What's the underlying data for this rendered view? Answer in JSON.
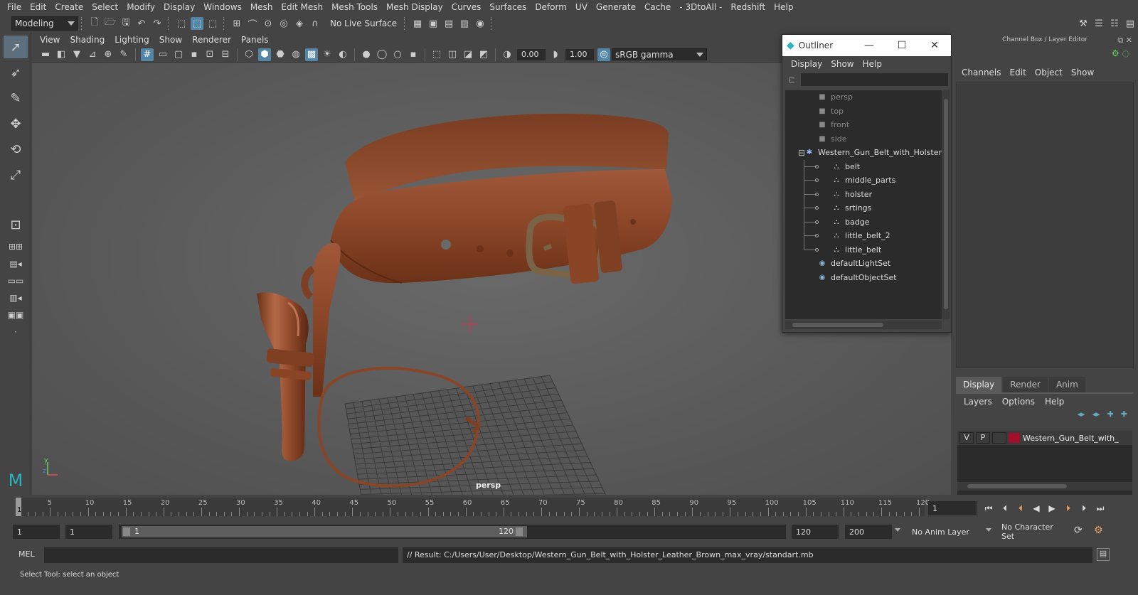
{
  "menubar": [
    "File",
    "Edit",
    "Create",
    "Select",
    "Modify",
    "Display",
    "Windows",
    "Mesh",
    "Edit Mesh",
    "Mesh Tools",
    "Mesh Display",
    "Curves",
    "Surfaces",
    "Deform",
    "UV",
    "Generate",
    "Cache",
    "- 3DtoAll -",
    "Redshift",
    "Help"
  ],
  "shelf": {
    "mode": "Modeling",
    "live_surface": "No Live Surface"
  },
  "viewport": {
    "menu": [
      "View",
      "Shading",
      "Lighting",
      "Show",
      "Renderer",
      "Panels"
    ],
    "exposure": "0.00",
    "gamma": "1.00",
    "color_space": "sRGB gamma",
    "camera_label": "persp"
  },
  "outliner": {
    "title": "Outliner",
    "menu": [
      "Display",
      "Show",
      "Help"
    ],
    "items": [
      {
        "label": "persp",
        "dim": true,
        "icon": "camera-icon"
      },
      {
        "label": "top",
        "dim": true,
        "icon": "camera-icon"
      },
      {
        "label": "front",
        "dim": true,
        "icon": "camera-icon"
      },
      {
        "label": "side",
        "dim": true,
        "icon": "camera-icon"
      },
      {
        "label": "Western_Gun_Belt_with_Holster",
        "dim": false,
        "icon": "group-icon"
      },
      {
        "label": "belt",
        "dim": false,
        "icon": "mesh-icon"
      },
      {
        "label": "middle_parts",
        "dim": false,
        "icon": "mesh-icon"
      },
      {
        "label": "holster",
        "dim": false,
        "icon": "mesh-icon"
      },
      {
        "label": "srtings",
        "dim": false,
        "icon": "mesh-icon"
      },
      {
        "label": "badge",
        "dim": false,
        "icon": "mesh-icon"
      },
      {
        "label": "little_belt_2",
        "dim": false,
        "icon": "mesh-icon"
      },
      {
        "label": "little_belt",
        "dim": false,
        "icon": "mesh-icon"
      },
      {
        "label": "defaultLightSet",
        "dim": false,
        "icon": "set-icon"
      },
      {
        "label": "defaultObjectSet",
        "dim": false,
        "icon": "set-icon"
      }
    ]
  },
  "channelbox": {
    "title": "Channel Box / Layer Editor",
    "menu": [
      "Channels",
      "Edit",
      "Object",
      "Show"
    ],
    "tabs": [
      "Display",
      "Render",
      "Anim"
    ],
    "layers_menu": [
      "Layers",
      "Options",
      "Help"
    ],
    "layer": {
      "v": "V",
      "p": "P",
      "name": "Western_Gun_Belt_with_",
      "color": "#a0102a"
    }
  },
  "timeline": {
    "ticks": [
      "5",
      "10",
      "15",
      "20",
      "25",
      "30",
      "35",
      "40",
      "45",
      "50",
      "55",
      "60",
      "65",
      "70",
      "75",
      "80",
      "85",
      "90",
      "95",
      "100",
      "105",
      "110",
      "115",
      "120"
    ],
    "current_frame_marker": "1",
    "current_frame": "1"
  },
  "range": {
    "start": "1",
    "playback_start": "1",
    "slider_start": "1",
    "slider_end": "120",
    "playback_end": "120",
    "end": "200",
    "anim_layer": "No Anim Layer",
    "character_set": "No Character Set"
  },
  "command": {
    "lang": "MEL",
    "result": "// Result: C:/Users/User/Desktop/Western_Gun_Belt_with_Holster_Leather_Brown_max_vray/standart.mb"
  },
  "status": "Select Tool: select an object"
}
